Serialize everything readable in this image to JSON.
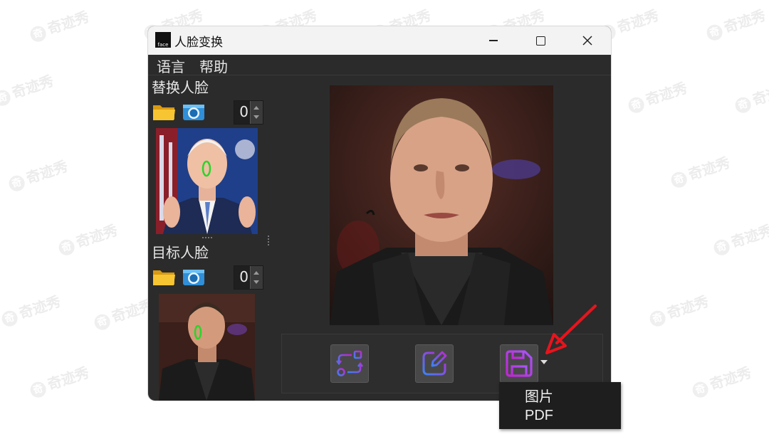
{
  "watermark": {
    "text": "奇迹秀"
  },
  "window": {
    "app_icon_text": "face",
    "title": "人脸变换"
  },
  "menu": {
    "language": "语言",
    "help": "帮助"
  },
  "source_face": {
    "label": "替换人脸",
    "count": "0",
    "icons": [
      "folder-icon",
      "camera-icon"
    ]
  },
  "target_face": {
    "label": "目标人脸",
    "count": "0",
    "icons": [
      "folder-icon",
      "camera-icon"
    ]
  },
  "toolbar": {
    "buttons": [
      "swap-icon",
      "edit-icon",
      "save-icon"
    ]
  },
  "save_menu": {
    "items": [
      "图片",
      "PDF"
    ]
  },
  "colors": {
    "accent_gradient_start": "#3b82f6",
    "accent_gradient_end": "#c026d3",
    "annotation_arrow": "#e8141c",
    "window_bg": "#2b2b2b"
  }
}
